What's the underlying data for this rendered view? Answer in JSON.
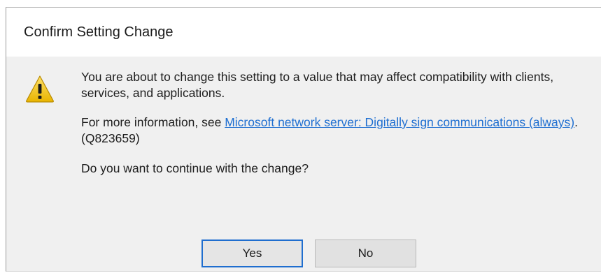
{
  "dialog": {
    "title": "Confirm Setting Change",
    "icon": "warning-icon",
    "message": "You are about to change this setting to a value that may affect compatibility with clients, services, and applications.",
    "info_prefix": "For more information, see ",
    "info_link": "Microsoft network server: Digitally sign communications (always)",
    "info_suffix": ". (Q823659)",
    "question": "Do you want to continue with the change?",
    "buttons": {
      "yes": "Yes",
      "no": "No"
    }
  },
  "colors": {
    "dialog_background": "#f0f0f0",
    "title_background": "#ffffff",
    "link": "#1f6fd1",
    "focus_border": "#1f6ecf",
    "warning_yellow": "#f2c200"
  }
}
